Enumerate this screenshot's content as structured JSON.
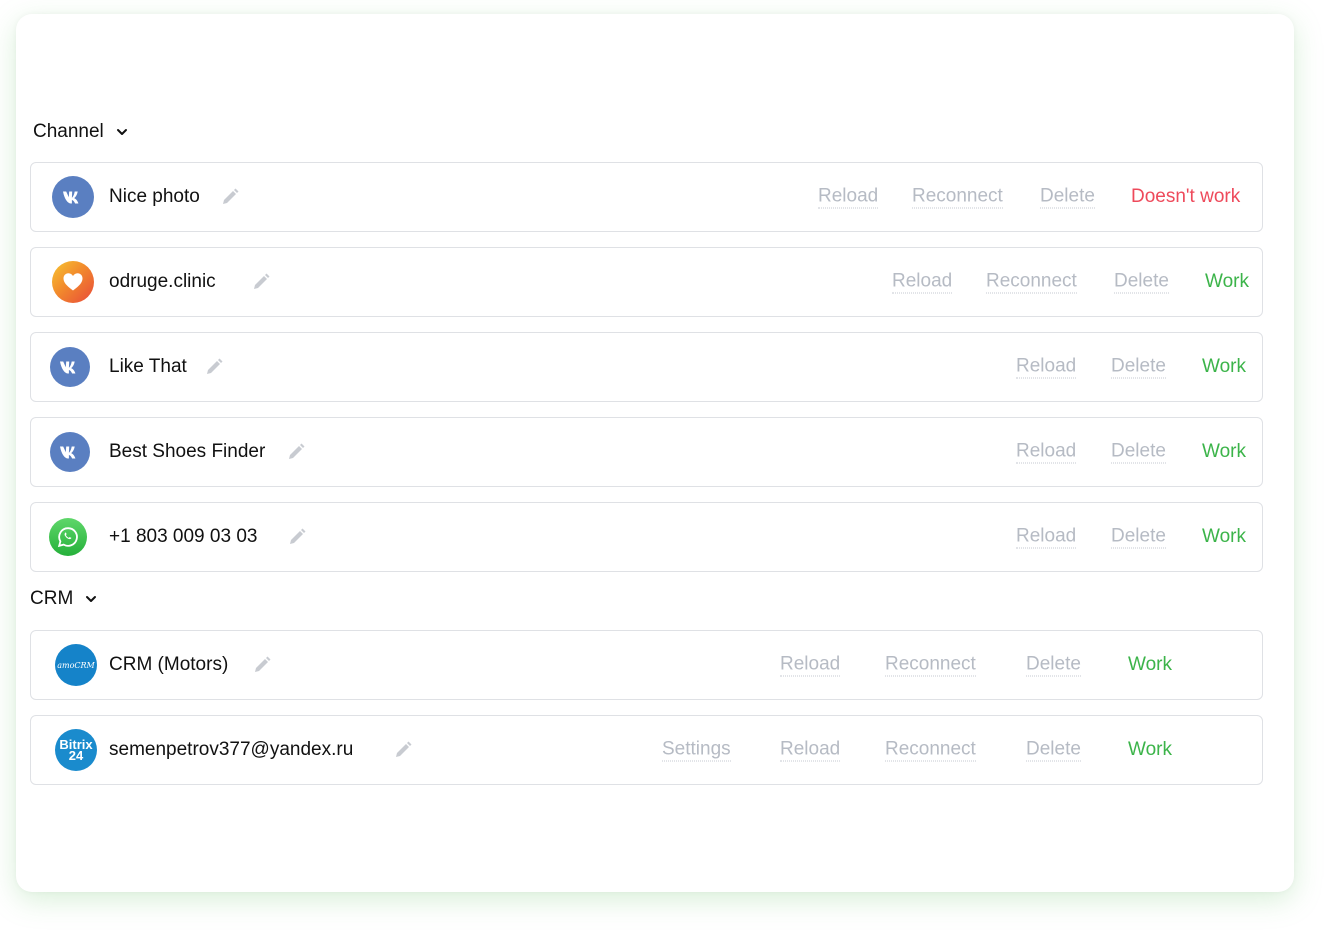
{
  "sections": {
    "channel": {
      "title": "Channel"
    },
    "crm": {
      "title": "CRM"
    }
  },
  "colors": {
    "status_ok": "#3cb44a",
    "status_bad": "#ee4a5b",
    "action_text": "#b6bbc4",
    "vk_blue": "#5a7fc1",
    "whatsapp_green": "#3bbd3f",
    "amocrm_blue": "#1583c9",
    "bitrix_blue": "#1a8bcd"
  },
  "channels": [
    {
      "name": "Nice photo",
      "icon": "vk-icon",
      "actions": {
        "reload": "Reload",
        "reconnect": "Reconnect",
        "delete": "Delete"
      },
      "status": "Doesn't work"
    },
    {
      "name": "odruge.clinic",
      "icon": "heart-icon",
      "actions": {
        "reload": "Reload",
        "reconnect": "Reconnect",
        "delete": "Delete"
      },
      "status": "Work"
    },
    {
      "name": "Like That",
      "icon": "vk-icon",
      "actions": {
        "reload": "Reload",
        "delete": "Delete"
      },
      "status": "Work"
    },
    {
      "name": "Best Shoes Finder",
      "icon": "vk-icon",
      "actions": {
        "reload": "Reload",
        "delete": "Delete"
      },
      "status": "Work"
    },
    {
      "name": "+1 803 009 03 03",
      "icon": "whatsapp-icon",
      "actions": {
        "reload": "Reload",
        "delete": "Delete"
      },
      "status": "Work"
    }
  ],
  "crm": [
    {
      "name": "CRM (Motors)",
      "icon": "amocrm-icon",
      "logo_text": "amoCRM",
      "actions": {
        "reload": "Reload",
        "reconnect": "Reconnect",
        "delete": "Delete"
      },
      "status": "Work"
    },
    {
      "name": "semenpetrov377@yandex.ru",
      "icon": "bitrix24-icon",
      "logo_text": "Bitrix 24",
      "actions": {
        "settings": "Settings",
        "reload": "Reload",
        "reconnect": "Reconnect",
        "delete": "Delete"
      },
      "status": "Work"
    }
  ]
}
